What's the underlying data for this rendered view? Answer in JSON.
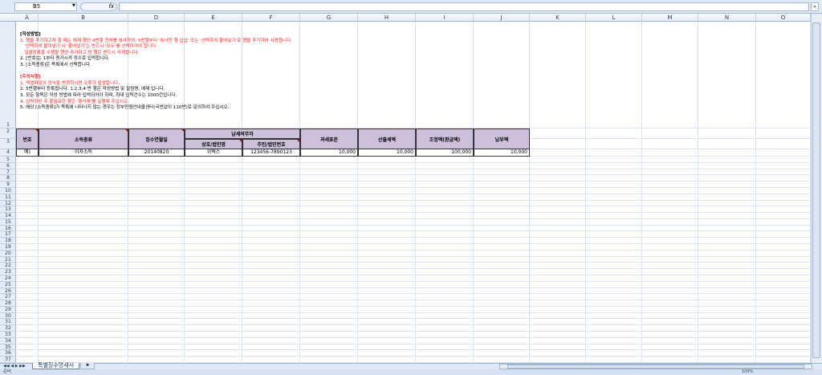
{
  "formula_bar": {
    "name_box": "B5",
    "fx": "fx",
    "expand": "»"
  },
  "columns": [
    "A",
    "B",
    "D",
    "E",
    "F",
    "G",
    "H",
    "I",
    "J",
    "K",
    "L",
    "M",
    "N",
    "O"
  ],
  "rows": [
    "1",
    "2",
    "3",
    "4",
    "5",
    "6",
    "7",
    "8",
    "9",
    "10",
    "11",
    "12",
    "13",
    "14",
    "15",
    "16",
    "17",
    "18",
    "19",
    "20",
    "21",
    "22",
    "23",
    "24",
    "25",
    "26",
    "27",
    "28",
    "29",
    "30",
    "31",
    "32",
    "33",
    "34",
    "35",
    "36",
    "37"
  ],
  "notes": [
    {
      "text": "[작성방법]",
      "cls": "bold"
    },
    {
      "text": "1. 행을 추가하고자 할 때는 예제 행인 4번행 전체를 복사하여, 5번행부터 '복사한 행 삽입' 또는 '선택하여 붙여넣기'로 행을 추가하여 사용합니다.",
      "cls": "red"
    },
    {
      "text": "   '선택하여 붙여넣기'시 '붙여넣기'는 반드시 '모두'를 선택하여야 합니다.",
      "cls": "red"
    },
    {
      "text": "   일괄등록을 수행할 행만 추가하고 빈 행은 반드시 삭제합니다.",
      "cls": "red"
    },
    {
      "text": "2. [번호]는 1부터 증가시켜 정수로 입력합니다.",
      "cls": ""
    },
    {
      "text": "3. [소득종류]은 목록에서 선택합니다.",
      "cls": ""
    },
    {
      "text": " ",
      "cls": ""
    },
    {
      "text": "[주의사항]",
      "cls": "red bold"
    },
    {
      "text": "1. 엑셀파일의 양식을 변경하시면 오류가 발생합니다.",
      "cls": "red"
    },
    {
      "text": "2. 5번행부터 등록됩니다. 1,2,3,4 번 행은 작성방법 및 칼럼명, 예제 입니다.",
      "cls": ""
    },
    {
      "text": "3. 모든 항목은 작성 방법에 따라 입력되어야 하며, 최대 입력건수는 1000건입니다.",
      "cls": ""
    },
    {
      "text": "4. 입력하신 후 불필요한 행은 '행삭제'를 실행해 주십시오.",
      "cls": "red"
    },
    {
      "text": "5. 해당 [소득종류]가 목록에 나타나지 않는 경우는 정부민원안내콜센터(국번없이 110번)로 문의하여 주십시오.",
      "cls": ""
    }
  ],
  "headers": {
    "no": "번호",
    "income_type": "소득종류",
    "date": "징수연월일",
    "taxpayer": "납세의무자",
    "name": "상호/법인명",
    "reg_no": "주민/법인번호",
    "tax_base": "과세표준",
    "calc_tax": "산출세액",
    "adjust": "조정액(환급액)",
    "paid": "납부액"
  },
  "example": {
    "no": "예)",
    "income_type": "이자소득",
    "date": "20140820",
    "name": "위택스",
    "reg_no": "123456-7890123",
    "tax_base": "10,000",
    "calc_tax": "10,000",
    "adjust": "100,000",
    "paid": "10,000"
  },
  "sheet_tab": "특별징수명세서",
  "status": {
    "ready": "준비",
    "zoom": "100%"
  }
}
